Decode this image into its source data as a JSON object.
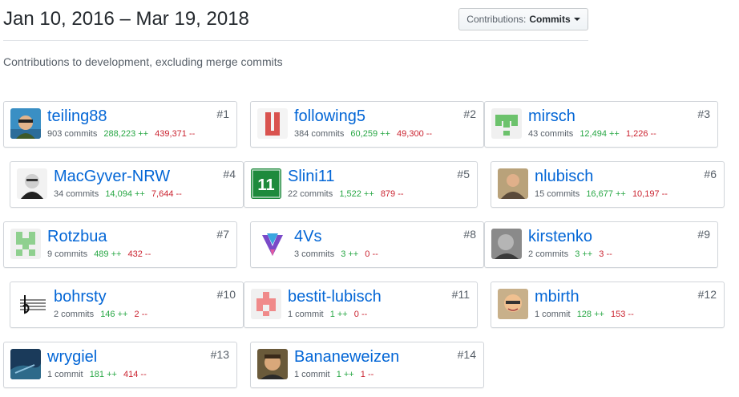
{
  "header": {
    "title": "Jan 10, 2016 – Mar 19, 2018",
    "dropdown_prefix": "Contributions:",
    "dropdown_value": "Commits",
    "subtitle": "Contributions to development, excluding merge commits"
  },
  "colors": {
    "link": "#0366d6",
    "additions": "#28a745",
    "deletions": "#cb2431",
    "muted": "#586069"
  },
  "contributors": [
    {
      "rank": "#1",
      "name": "teiling88",
      "commits": "903 commits",
      "additions": "288,223 ++",
      "deletions": "439,371 --",
      "avatar_icon": "photo-avatar-icon"
    },
    {
      "rank": "#2",
      "name": "following5",
      "commits": "384 commits",
      "additions": "60,259 ++",
      "deletions": "49,300 --",
      "avatar_icon": "red-logo-avatar-icon"
    },
    {
      "rank": "#3",
      "name": "mirsch",
      "commits": "43 commits",
      "additions": "12,494 ++",
      "deletions": "1,226 --",
      "avatar_icon": "identicon-avatar-icon"
    },
    {
      "rank": "#4",
      "name": "MacGyver-NRW",
      "commits": "34 commits",
      "additions": "14,094 ++",
      "deletions": "7,644 --",
      "avatar_icon": "photo-avatar-icon"
    },
    {
      "rank": "#5",
      "name": "Slini11",
      "commits": "22 commits",
      "additions": "1,522 ++",
      "deletions": "879 --",
      "avatar_icon": "text-logo-avatar-icon",
      "avatar_text": "11"
    },
    {
      "rank": "#6",
      "name": "nlubisch",
      "commits": "15 commits",
      "additions": "16,677 ++",
      "deletions": "10,197 --",
      "avatar_icon": "photo-avatar-icon"
    },
    {
      "rank": "#7",
      "name": "Rotzbua",
      "commits": "9 commits",
      "additions": "489 ++",
      "deletions": "432 --",
      "avatar_icon": "identicon-avatar-icon"
    },
    {
      "rank": "#8",
      "name": "4Vs",
      "commits": "3 commits",
      "additions": "3 ++",
      "deletions": "0 --",
      "avatar_icon": "logo-avatar-icon"
    },
    {
      "rank": "#9",
      "name": "kirstenko",
      "commits": "2 commits",
      "additions": "3 ++",
      "deletions": "3 --",
      "avatar_icon": "photo-avatar-icon"
    },
    {
      "rank": "#10",
      "name": "bohrsty",
      "commits": "2 commits",
      "additions": "146 ++",
      "deletions": "2 --",
      "avatar_icon": "music-logo-avatar-icon"
    },
    {
      "rank": "#11",
      "name": "bestit-lubisch",
      "commits": "1 commit",
      "additions": "1 ++",
      "deletions": "0 --",
      "avatar_icon": "identicon-avatar-icon"
    },
    {
      "rank": "#12",
      "name": "mbirth",
      "commits": "1 commit",
      "additions": "128 ++",
      "deletions": "153 --",
      "avatar_icon": "photo-avatar-icon"
    },
    {
      "rank": "#13",
      "name": "wrygiel",
      "commits": "1 commit",
      "additions": "181 ++",
      "deletions": "414 --",
      "avatar_icon": "photo-avatar-icon"
    },
    {
      "rank": "#14",
      "name": "Bananeweizen",
      "commits": "1 commit",
      "additions": "1 ++",
      "deletions": "1 --",
      "avatar_icon": "photo-avatar-icon"
    }
  ]
}
